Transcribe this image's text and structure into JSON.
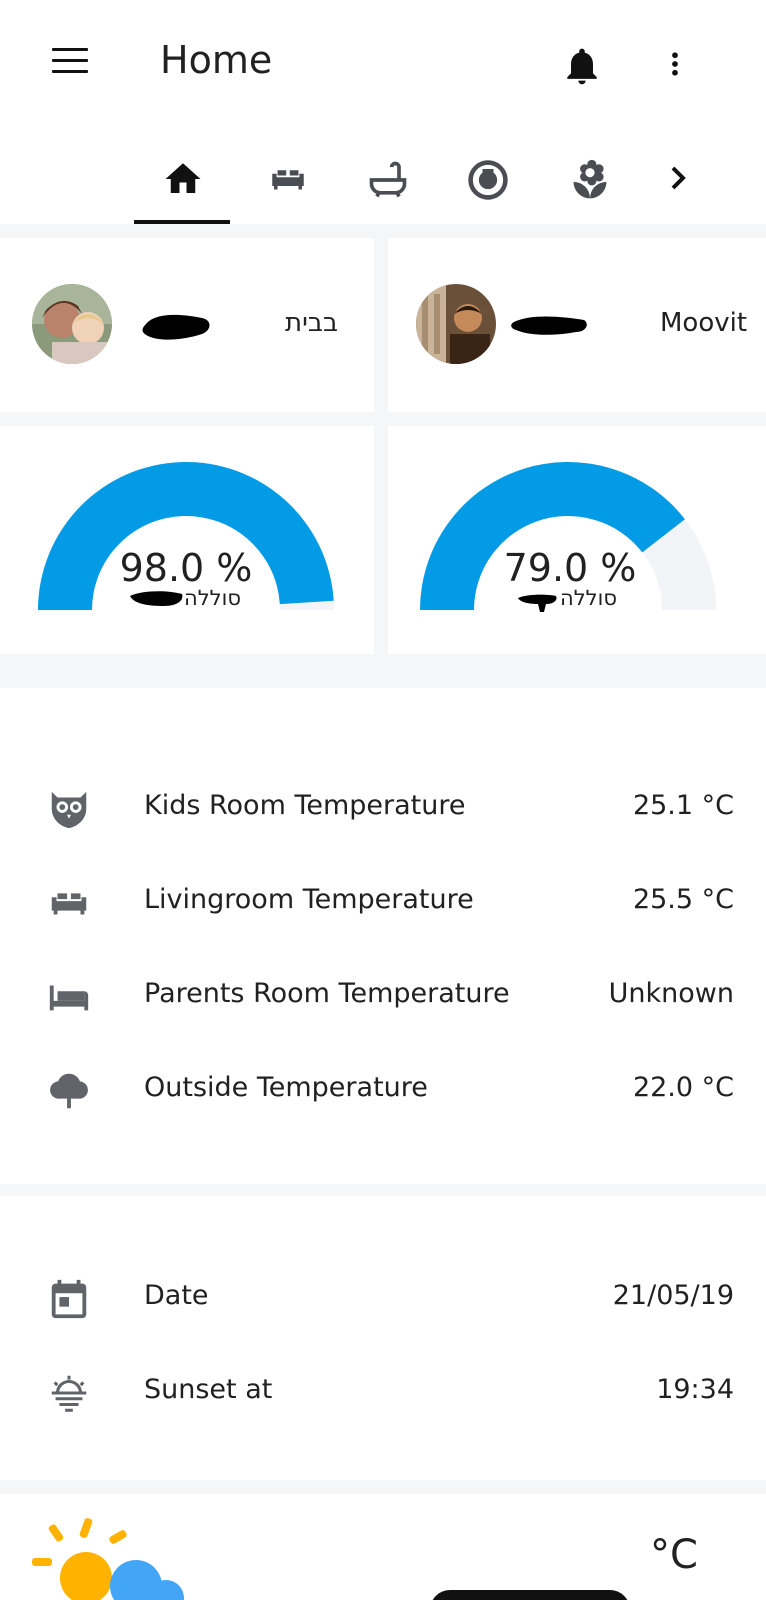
{
  "app": {
    "title": "Home"
  },
  "tabs": [
    {
      "icon": "home-icon",
      "active": true
    },
    {
      "icon": "sofa-icon",
      "active": false
    },
    {
      "icon": "bathtub-icon",
      "active": false
    },
    {
      "icon": "robot-vacuum-icon",
      "active": false
    },
    {
      "icon": "flower-icon",
      "active": false
    },
    {
      "icon": "chevron-right-icon",
      "active": false
    }
  ],
  "persons": [
    {
      "name": "בבית"
    },
    {
      "name": "Moovit"
    }
  ],
  "gauges": [
    {
      "value": "98.0 %",
      "label": "סוללה",
      "fraction": 0.98
    },
    {
      "value": "79.0 %",
      "label": "סוללה",
      "fraction": 0.79
    }
  ],
  "temperatures": [
    {
      "icon": "owl-icon",
      "label": "Kids Room Temperature",
      "value": "25.1 °C"
    },
    {
      "icon": "sofa-icon",
      "label": "Livingroom Temperature",
      "value": "25.5 °C"
    },
    {
      "icon": "bed-icon",
      "label": "Parents Room Temperature",
      "value": "Unknown"
    },
    {
      "icon": "tree-icon",
      "label": "Outside Temperature",
      "value": "22.0 °C"
    }
  ],
  "info": [
    {
      "icon": "calendar-icon",
      "label": "Date",
      "value": "21/05/19"
    },
    {
      "icon": "sunset-icon",
      "label": "Sunset at",
      "value": "19:34"
    }
  ],
  "weather": {
    "icon": "partly-cloudy-icon",
    "unit": "°C"
  },
  "colors": {
    "accent": "#039be5",
    "gauge_track": "#f2f4f7",
    "icon_gray": "#606468"
  }
}
